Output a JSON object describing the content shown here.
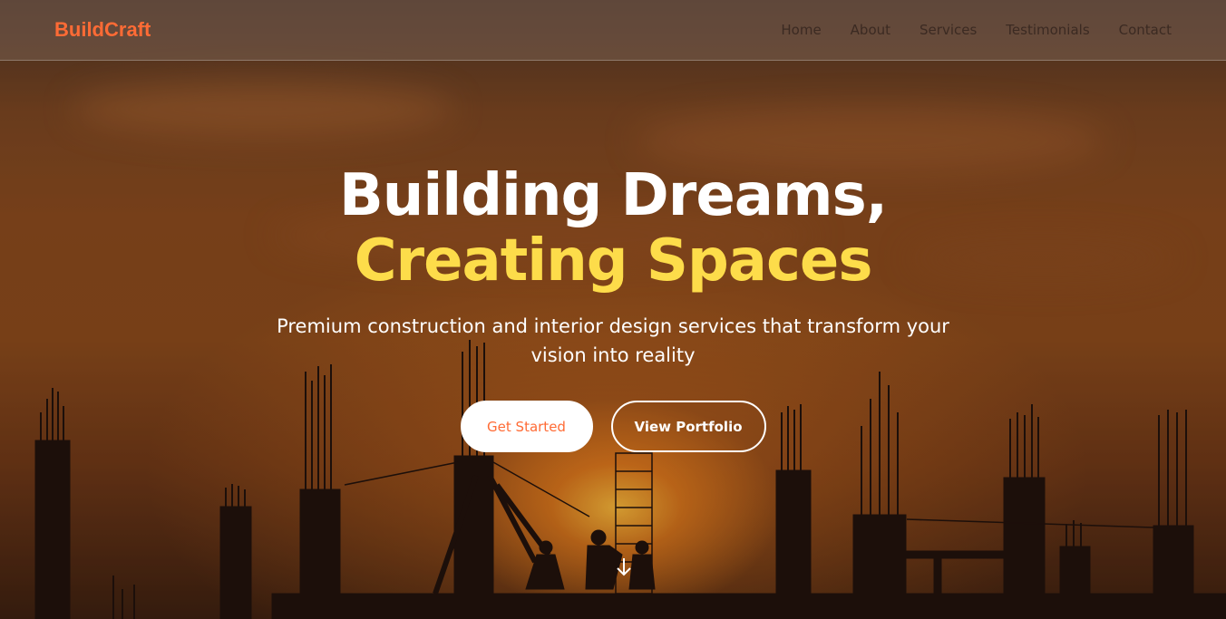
{
  "nav": {
    "logo": "BuildCraft",
    "links": [
      "Home",
      "About",
      "Services",
      "Testimonials",
      "Contact"
    ]
  },
  "hero": {
    "title_line1": "Building Dreams,",
    "title_line2": "Creating Spaces",
    "subtitle": "Premium construction and interior design services that transform your vision into reality",
    "primary_button": "Get Started",
    "secondary_button": "View Portfolio"
  },
  "colors": {
    "accent": "#ff6b35",
    "highlight": "#fddc4a",
    "text_light": "#ffffff"
  },
  "icons": {
    "scroll": "arrow-down-icon"
  }
}
